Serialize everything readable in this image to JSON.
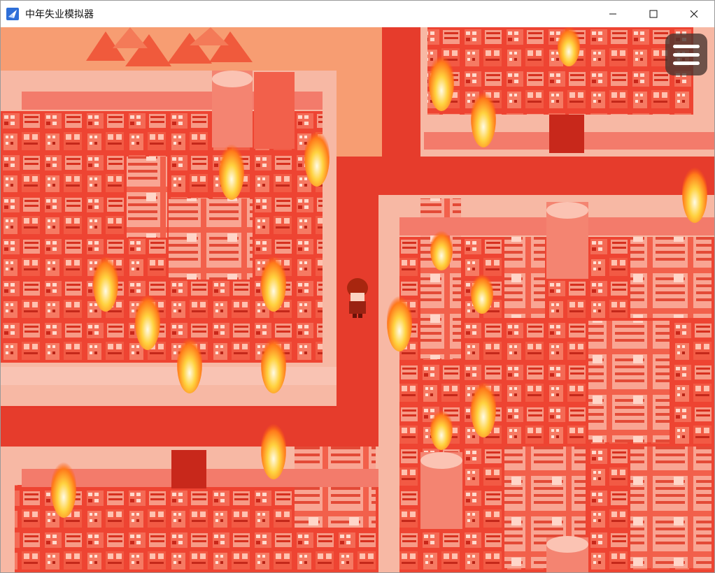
{
  "window": {
    "title": "中年失业模拟器",
    "icon": "app-icon",
    "controls": [
      "minimize-icon",
      "maximize-icon",
      "close-icon"
    ]
  },
  "game": {
    "menu_icon": "hamburger-menu-icon",
    "tint_color": "#ef3a25",
    "road_color": "#e5382a",
    "sidewalk_color": "#f7b8a4",
    "fire_color": "#ffb93a"
  }
}
